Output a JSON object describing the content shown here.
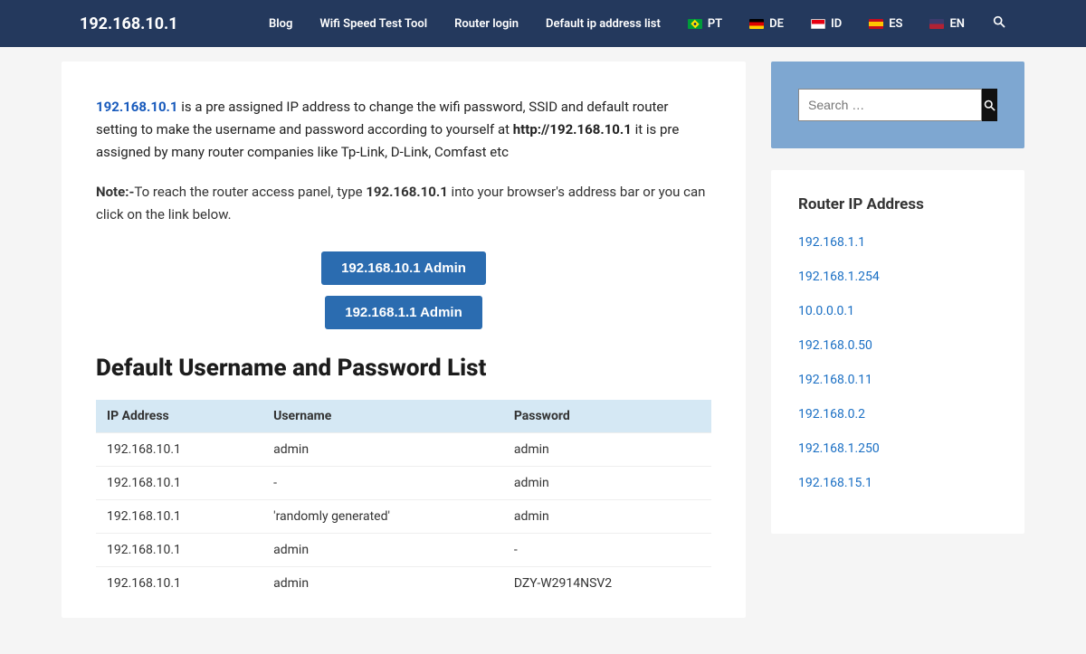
{
  "header": {
    "brand": "192.168.10.1",
    "nav": [
      "Blog",
      "Wifi Speed Test Tool",
      "Router login",
      "Default ip address list"
    ],
    "langs": [
      {
        "code": "PT",
        "flag": "flag-br"
      },
      {
        "code": "DE",
        "flag": "flag-de"
      },
      {
        "code": "ID",
        "flag": "flag-id"
      },
      {
        "code": "ES",
        "flag": "flag-es"
      },
      {
        "code": "EN",
        "flag": "flag-us"
      }
    ]
  },
  "intro": {
    "ip_link": "192.168.10.1",
    "part1": " is a pre assigned IP address to change the wifi password, SSID and default router setting to make the username and password according to yourself at ",
    "bold_url": "http://192.168.10.1",
    "part2": " it is pre assigned by many router companies like Tp-Link, D-Link, Comfast etc"
  },
  "note": {
    "label": "Note:-",
    "part1": "To reach the router access panel, type ",
    "bold_ip": "192.168.10.1",
    "part2": " into your browser's address bar or you can click on the link below."
  },
  "buttons": {
    "b1": "192.168.10.1 Admin",
    "b2": "192.168.1.1 Admin"
  },
  "section_title": "Default Username and Password List",
  "table": {
    "cols": [
      "IP Address",
      "Username",
      "Password"
    ],
    "rows": [
      [
        "192.168.10.1",
        "admin",
        "admin"
      ],
      [
        "192.168.10.1",
        "-",
        "admin"
      ],
      [
        "192.168.10.1",
        "'randomly generated'",
        "admin"
      ],
      [
        "192.168.10.1",
        "admin",
        "-"
      ],
      [
        "192.168.10.1",
        "admin",
        "DZY-W2914NSV2"
      ]
    ]
  },
  "sidebar": {
    "search_placeholder": "Search …",
    "widget_title": "Router IP Address",
    "links": [
      "192.168.1.1",
      "192.168.1.254",
      "10.0.0.0.1",
      "192.168.0.50",
      "192.168.0.11",
      "192.168.0.2",
      "192.168.1.250",
      "192.168.15.1"
    ]
  }
}
